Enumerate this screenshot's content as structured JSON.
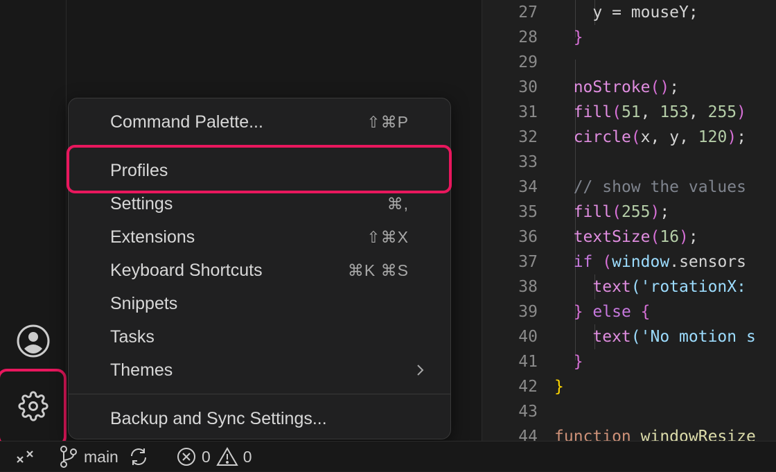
{
  "activity_bar": {
    "account_icon": "account-icon",
    "manage_icon": "gear-icon"
  },
  "menu": {
    "items": [
      {
        "label": "Command Palette...",
        "shortcut": "⇧⌘P"
      },
      {
        "label": "Profiles",
        "shortcut": ""
      },
      {
        "label": "Settings",
        "shortcut": "⌘,"
      },
      {
        "label": "Extensions",
        "shortcut": "⇧⌘X"
      },
      {
        "label": "Keyboard Shortcuts",
        "shortcut": "⌘K ⌘S"
      },
      {
        "label": "Snippets",
        "shortcut": ""
      },
      {
        "label": "Tasks",
        "shortcut": ""
      },
      {
        "label": "Themes",
        "shortcut": ""
      },
      {
        "label": "Backup and Sync Settings...",
        "shortcut": ""
      }
    ],
    "submenu_icon": "chevron-right-icon"
  },
  "editor": {
    "lines": [
      {
        "num": "27",
        "tokens": [
          [
            "    ",
            "p"
          ],
          [
            "y",
            "p"
          ],
          [
            " = ",
            "p"
          ],
          [
            "mouseY",
            "p"
          ],
          [
            ";",
            "p"
          ]
        ]
      },
      {
        "num": "28",
        "tokens": [
          [
            "  ",
            "p"
          ],
          [
            "}",
            "pm"
          ]
        ]
      },
      {
        "num": "29",
        "tokens": []
      },
      {
        "num": "30",
        "tokens": [
          [
            "  ",
            "p"
          ],
          [
            "noStroke",
            "fm"
          ],
          [
            "()",
            "pm"
          ],
          [
            ";",
            "p"
          ]
        ]
      },
      {
        "num": "31",
        "tokens": [
          [
            "  ",
            "p"
          ],
          [
            "fill",
            "fm"
          ],
          [
            "(",
            "pm"
          ],
          [
            "51",
            "n"
          ],
          [
            ", ",
            "p"
          ],
          [
            "153",
            "n"
          ],
          [
            ", ",
            "p"
          ],
          [
            "255",
            "n"
          ],
          [
            ")",
            "pm"
          ]
        ]
      },
      {
        "num": "32",
        "tokens": [
          [
            "  ",
            "p"
          ],
          [
            "circle",
            "fm"
          ],
          [
            "(",
            "pm"
          ],
          [
            "x",
            "p"
          ],
          [
            ", ",
            "p"
          ],
          [
            "y",
            "p"
          ],
          [
            ", ",
            "p"
          ],
          [
            "120",
            "n"
          ],
          [
            ")",
            "pm"
          ],
          [
            ";",
            "p"
          ]
        ]
      },
      {
        "num": "33",
        "tokens": []
      },
      {
        "num": "34",
        "tokens": [
          [
            "  ",
            "p"
          ],
          [
            "// show the values",
            "c"
          ]
        ]
      },
      {
        "num": "35",
        "tokens": [
          [
            "  ",
            "p"
          ],
          [
            "fill",
            "fm"
          ],
          [
            "(",
            "pm"
          ],
          [
            "255",
            "n"
          ],
          [
            ")",
            "pm"
          ],
          [
            ";",
            "p"
          ]
        ]
      },
      {
        "num": "36",
        "tokens": [
          [
            "  ",
            "p"
          ],
          [
            "textSize",
            "fm"
          ],
          [
            "(",
            "pm"
          ],
          [
            "16",
            "n"
          ],
          [
            ")",
            "pm"
          ],
          [
            ";",
            "p"
          ]
        ]
      },
      {
        "num": "37",
        "tokens": [
          [
            "  ",
            "p"
          ],
          [
            "if",
            "k"
          ],
          [
            " (",
            "pm"
          ],
          [
            "window",
            "v"
          ],
          [
            ".",
            "p"
          ],
          [
            "sensors",
            "p"
          ]
        ]
      },
      {
        "num": "38",
        "tokens": [
          [
            "    ",
            "p"
          ],
          [
            "text",
            "fm"
          ],
          [
            "(",
            "v"
          ],
          [
            "'rotationX:",
            "v"
          ]
        ]
      },
      {
        "num": "39",
        "tokens": [
          [
            "  ",
            "p"
          ],
          [
            "}",
            "pm"
          ],
          [
            " else ",
            "k"
          ],
          [
            "{",
            "pm"
          ]
        ]
      },
      {
        "num": "40",
        "tokens": [
          [
            "    ",
            "p"
          ],
          [
            "text",
            "fm"
          ],
          [
            "(",
            "v"
          ],
          [
            "'No motion s",
            "v"
          ]
        ]
      },
      {
        "num": "41",
        "tokens": [
          [
            "  ",
            "p"
          ],
          [
            "}",
            "pm"
          ]
        ]
      },
      {
        "num": "42",
        "tokens": [
          [
            "}",
            "py"
          ]
        ]
      },
      {
        "num": "43",
        "tokens": []
      },
      {
        "num": "44",
        "tokens": [
          [
            "function",
            "s"
          ],
          [
            " ",
            "p"
          ],
          [
            "windowResize",
            "f"
          ]
        ]
      }
    ]
  },
  "status_bar": {
    "remote_icon": "remote-icon",
    "branch_icon": "git-branch-icon",
    "branch": "main",
    "sync_icon": "sync-icon",
    "errors_icon": "error-icon",
    "errors": "0",
    "warnings_icon": "warning-icon",
    "warnings": "0"
  },
  "colors": {
    "highlight": "#e8175d",
    "background": "#1f1f1f",
    "menu_bg": "#202021"
  }
}
